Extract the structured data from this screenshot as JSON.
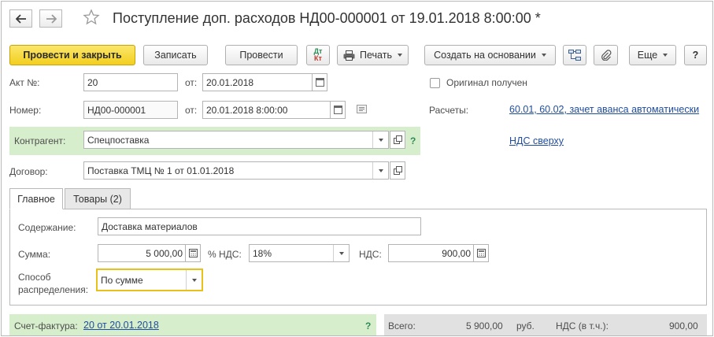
{
  "header": {
    "title": "Поступление доп. расходов НД00-000001 от 19.01.2018 8:00:00 *"
  },
  "toolbar": {
    "post_close": "Провести и закрыть",
    "save": "Записать",
    "post": "Провести",
    "dt_kt_dt": "Дт",
    "dt_kt_kt": "Кт",
    "print": "Печать",
    "create_based": "Создать на основании",
    "more": "Еще",
    "help": "?"
  },
  "form": {
    "act_label": "Акт №:",
    "act_value": "20",
    "from_label_1": "от:",
    "act_date": "20.01.2018",
    "number_label": "Номер:",
    "number_value": "НД00-000001",
    "from_label_2": "от:",
    "number_date": "20.01.2018  8:00:00",
    "original_label": "Оригинал получен",
    "original_checked": false,
    "settlements_label": "Расчеты:",
    "settlements_link": "60.01, 60.02, зачет аванса автоматически",
    "counterparty_label": "Контрагент:",
    "counterparty_value": "Спецпоставка",
    "counterparty_help": "?",
    "vat_link": "НДС сверху",
    "contract_label": "Договор:",
    "contract_value": "Поставка ТМЦ № 1 от 01.01.2018"
  },
  "tabs": [
    {
      "label": "Главное",
      "active": true
    },
    {
      "label": "Товары (2)",
      "active": false
    }
  ],
  "main": {
    "content_label": "Содержание:",
    "content_value": "Доставка материалов",
    "sum_label": "Сумма:",
    "sum_value": "5 000,00",
    "vat_rate_label": "% НДС:",
    "vat_rate_value": "18%",
    "vat_label": "НДС:",
    "vat_value": "900,00",
    "distribution_label_1": "Способ",
    "distribution_label_2": "распределения:",
    "distribution_value": "По сумме"
  },
  "footer": {
    "invoice_label": "Счет-фактура:",
    "invoice_link": "20 от 20.01.2018",
    "invoice_help": "?",
    "total_label": "Всего:",
    "total_value": "5 900,00",
    "currency": "руб.",
    "vat_incl_label": "НДС (в т.ч.):",
    "vat_incl_value": "900,00"
  },
  "colors": {
    "primary_button": "#f2cf1f",
    "link": "#1f4d9c",
    "highlight_band": "#d7eecc",
    "focus_border": "#e8c21a",
    "totals_band": "#e1e1e1"
  }
}
